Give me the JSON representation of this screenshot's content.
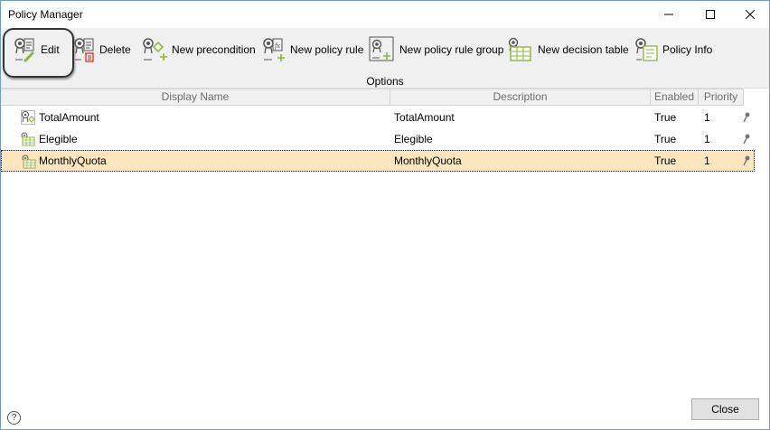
{
  "window": {
    "title": "Policy Manager"
  },
  "toolbar": {
    "buttons": [
      {
        "label": "Edit",
        "icon": "edit-policy-icon"
      },
      {
        "label": "Delete",
        "icon": "delete-policy-icon"
      },
      {
        "label": "New precondition",
        "icon": "new-precondition-icon"
      },
      {
        "label": "New policy rule",
        "icon": "new-policy-rule-icon"
      },
      {
        "label": "New policy rule group",
        "icon": "new-policy-rule-group-icon"
      },
      {
        "label": "New decision table",
        "icon": "new-decision-table-icon"
      },
      {
        "label": "Policy Info",
        "icon": "policy-info-icon"
      }
    ],
    "group_label": "Options"
  },
  "grid": {
    "columns": [
      "Display Name",
      "Description",
      "Enabled",
      "Priority"
    ],
    "rows": [
      {
        "name": "TotalAmount",
        "description": "TotalAmount",
        "enabled": "True",
        "priority": "1",
        "icon": "precondition-icon",
        "selected": false
      },
      {
        "name": "Elegible",
        "description": "Elegible",
        "enabled": "True",
        "priority": "1",
        "icon": "decision-table-icon",
        "selected": false
      },
      {
        "name": "MonthlyQuota",
        "description": "MonthlyQuota",
        "enabled": "True",
        "priority": "1",
        "icon": "decision-table-icon",
        "selected": true
      }
    ]
  },
  "footer": {
    "close_label": "Close",
    "help_glyph": "?"
  },
  "colors": {
    "selected_row": "#fde6be",
    "toolbar_bg": "#f0f0f0",
    "icon_green": "#8fb43a"
  }
}
